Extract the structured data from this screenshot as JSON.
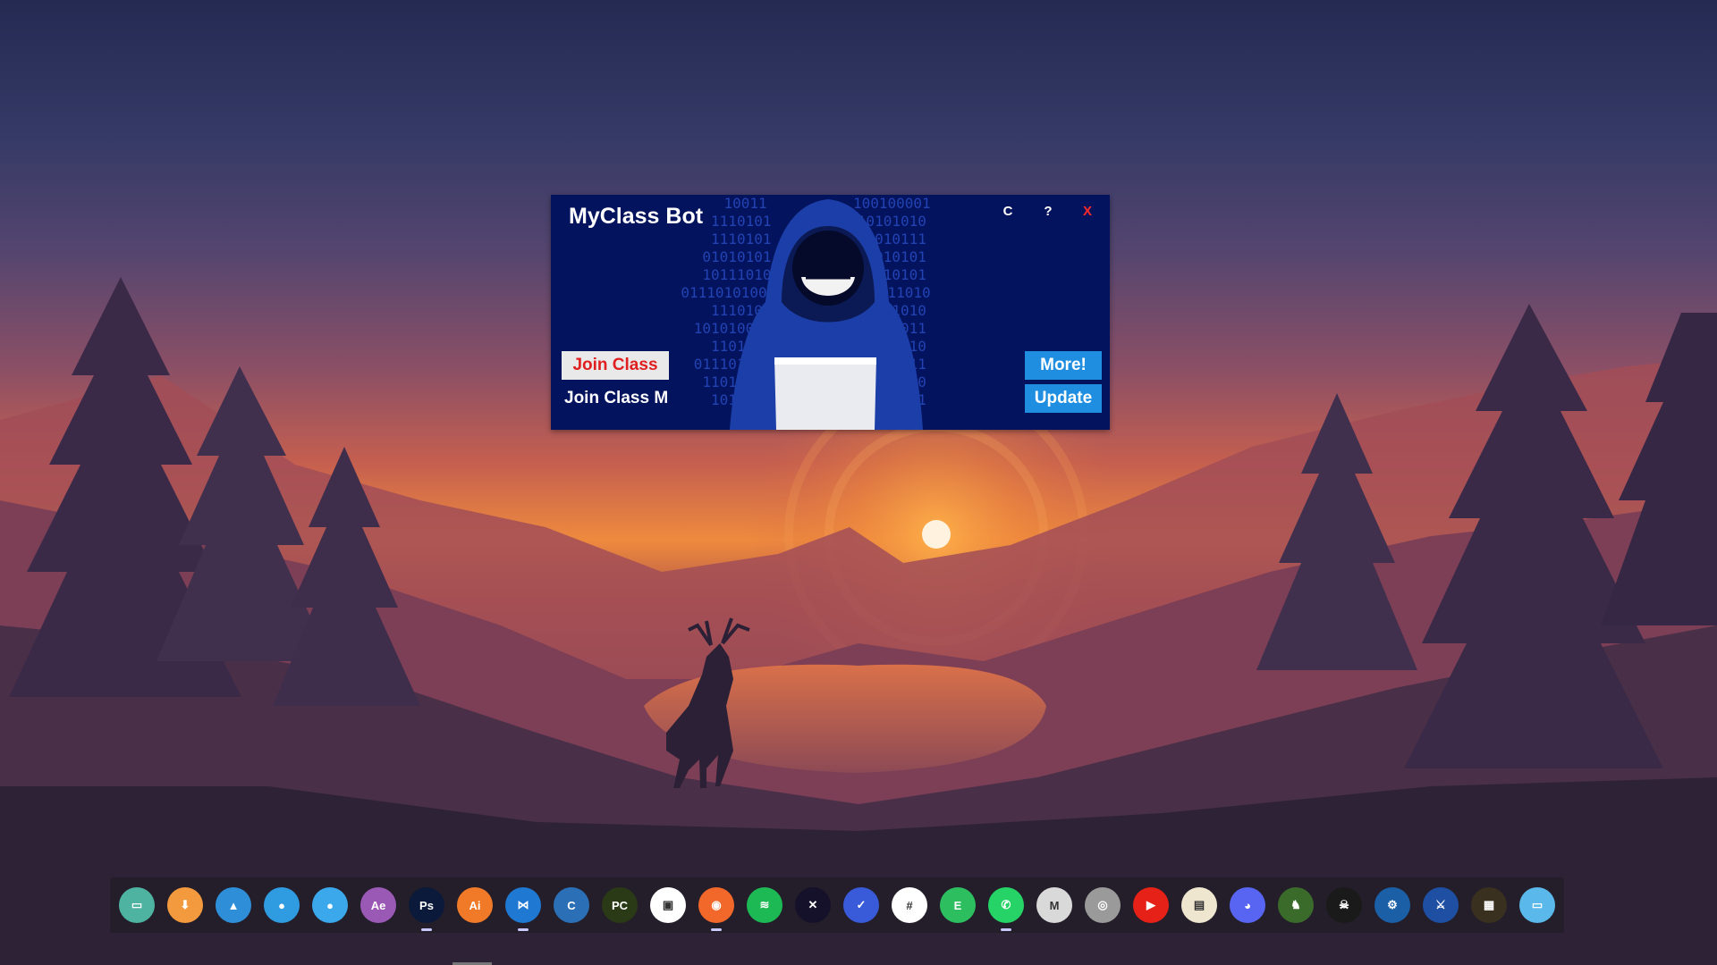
{
  "bot_window": {
    "title": "MyClass Bot",
    "controls": {
      "c": "C",
      "help": "?",
      "close": "X"
    },
    "join_class_button": "Join Class",
    "join_class_m": "Join Class M",
    "more_button": "More!",
    "update_button": "Update",
    "binary_lines": [
      "10011",
      "1110101",
      "1110101",
      "01010101",
      "10111010",
      "0111010100",
      "1110101",
      "101010010",
      "1101010",
      "011101010",
      "11010101",
      "1010101"
    ],
    "binary_lines_right": [
      "100100001",
      "10101010",
      "11010111",
      "11010101",
      "11010101",
      "101111010",
      "01011010",
      "11101011",
      "01010110",
      "10101011",
      "10101010",
      "10101101"
    ]
  },
  "dock": {
    "items": [
      {
        "icon": "desktop-icon",
        "glyph": "▭",
        "color": "#4fb3a2"
      },
      {
        "icon": "download-icon",
        "glyph": "⬇",
        "color": "#f39a3e"
      },
      {
        "icon": "photos-icon",
        "glyph": "▲",
        "color": "#2e8fd8"
      },
      {
        "icon": "user-upload-icon",
        "glyph": "●",
        "color": "#2f9be0"
      },
      {
        "icon": "user-transfer-icon",
        "glyph": "●",
        "color": "#3aa8ea"
      },
      {
        "icon": "after-effects-icon",
        "glyph": "Ae",
        "color": "#9b59b6"
      },
      {
        "icon": "photoshop-icon",
        "glyph": "Ps",
        "color": "#0b1a3a",
        "active": true
      },
      {
        "icon": "illustrator-icon",
        "glyph": "Ai",
        "color": "#f07a28"
      },
      {
        "icon": "vscode-icon",
        "glyph": "⋈",
        "color": "#1f78d1",
        "active": true
      },
      {
        "icon": "c-language-icon",
        "glyph": "C",
        "color": "#2b6fb6"
      },
      {
        "icon": "pycharm-icon",
        "glyph": "PC",
        "color": "#2a3a16"
      },
      {
        "icon": "screen-share-icon",
        "glyph": "▣",
        "color": "#ffffff"
      },
      {
        "icon": "firefox-icon",
        "glyph": "◉",
        "color": "#f2682a",
        "active": true
      },
      {
        "icon": "spotify-icon",
        "glyph": "≋",
        "color": "#1db954"
      },
      {
        "icon": "hacker-tool-icon",
        "glyph": "✕",
        "color": "#16112a"
      },
      {
        "icon": "tasks-check-icon",
        "glyph": "✓",
        "color": "#3a5bd9"
      },
      {
        "icon": "slack-icon",
        "glyph": "#",
        "color": "#ffffff"
      },
      {
        "icon": "evernote-icon",
        "glyph": "E",
        "color": "#2dbe60"
      },
      {
        "icon": "whatsapp-icon",
        "glyph": "✆",
        "color": "#25d366",
        "active": true
      },
      {
        "icon": "gmail-icon",
        "glyph": "M",
        "color": "#d9d9d9"
      },
      {
        "icon": "camera-icon",
        "glyph": "◎",
        "color": "#9a9a9a"
      },
      {
        "icon": "youtube-icon",
        "glyph": "▶",
        "color": "#e62117"
      },
      {
        "icon": "document-viewer-icon",
        "glyph": "▤",
        "color": "#efe6d0"
      },
      {
        "icon": "discord-icon",
        "glyph": "◕",
        "color": "#5865f2"
      },
      {
        "icon": "game-dragon-icon",
        "glyph": "♞",
        "color": "#3b6b2a"
      },
      {
        "icon": "game-shooter-icon",
        "glyph": "☠",
        "color": "#1a1a1a"
      },
      {
        "icon": "steam-icon",
        "glyph": "⚙",
        "color": "#1b5fa6"
      },
      {
        "icon": "team-app-icon",
        "glyph": "⚔",
        "color": "#1e4fa3"
      },
      {
        "icon": "archive-icon",
        "glyph": "▦",
        "color": "#3a3020"
      },
      {
        "icon": "folder-drive-icon",
        "glyph": "▭",
        "color": "#5ab8ea"
      }
    ]
  }
}
